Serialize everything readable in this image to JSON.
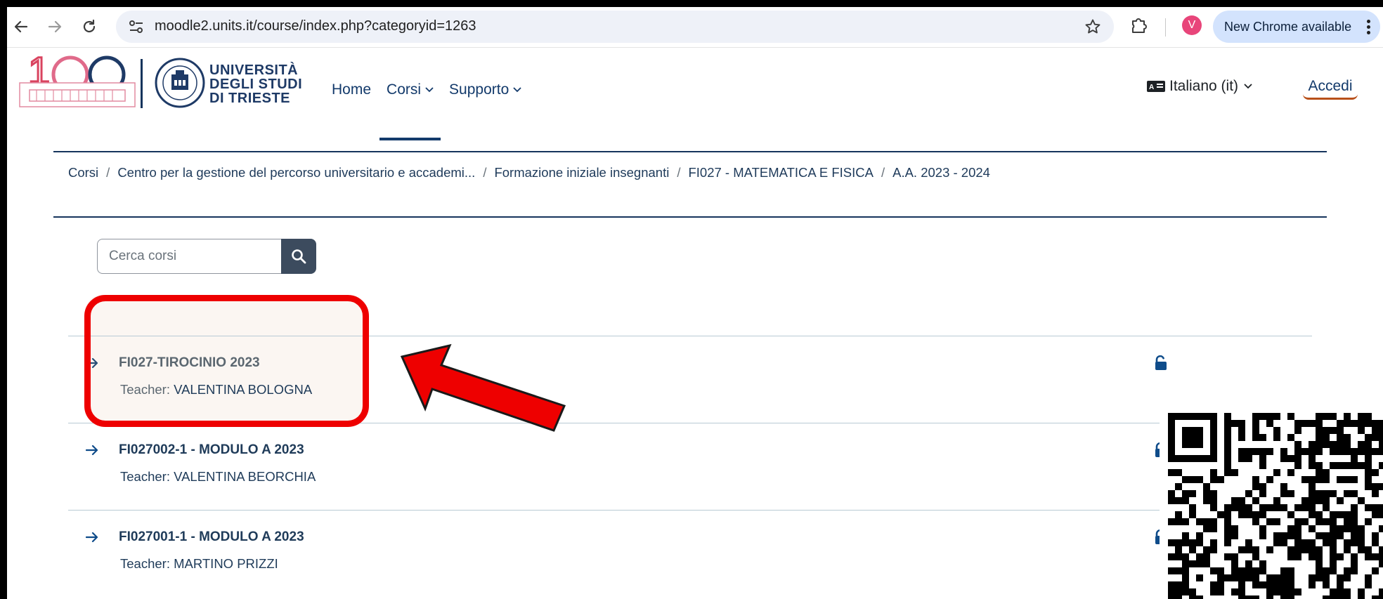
{
  "browser": {
    "url": "moodle2.units.it/course/index.php?categoryid=1263",
    "profile_initial": "V",
    "update_label": "New Chrome available"
  },
  "header": {
    "university_lines": [
      "UNIVERSITÀ",
      "DEGLI STUDI",
      "DI TRIESTE"
    ],
    "nav": [
      {
        "label": "Home",
        "dropdown": false
      },
      {
        "label": "Corsi",
        "dropdown": true,
        "active": true
      },
      {
        "label": "Supporto",
        "dropdown": true
      }
    ],
    "language": "Italiano (it)",
    "login": "Accedi"
  },
  "breadcrumb": [
    "Corsi",
    "Centro per la gestione del percorso universitario e accademi...",
    "Formazione iniziale insegnanti",
    "FI027 - MATEMATICA E FISICA",
    "A.A. 2023 - 2024"
  ],
  "search": {
    "placeholder": "Cerca corsi"
  },
  "courses": [
    {
      "title": "FI027-TIROCINIO 2023",
      "teacher_label": "Teacher:",
      "teacher": "VALENTINA BOLOGNA"
    },
    {
      "title": "FI027002-1 - MODULO A 2023",
      "teacher_label": "Teacher:",
      "teacher": "VALENTINA BEORCHIA"
    },
    {
      "title": "FI027001-1 - MODULO A 2023",
      "teacher_label": "Teacher:",
      "teacher": "MARTINO PRIZZI"
    }
  ],
  "colors": {
    "brand_navy": "#133a6b",
    "annotation_red": "#ee0000",
    "accent_orange": "#b8501a"
  }
}
